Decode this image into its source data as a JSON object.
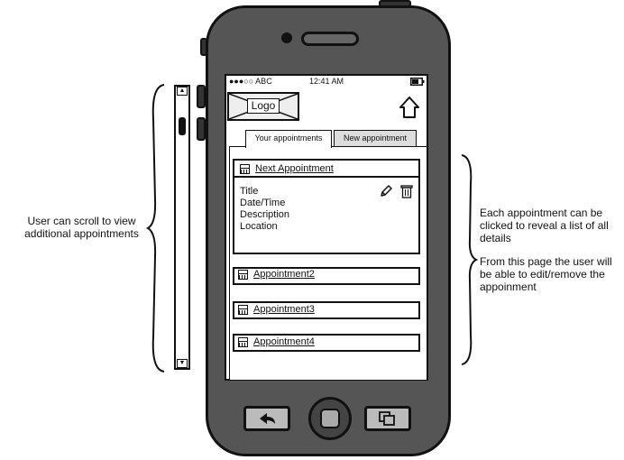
{
  "annotations": {
    "scroll_note": "User can scroll to view additional appointments",
    "click_note": "Each appointment can be clicked to reveal a list of all details",
    "edit_note": "From this page the user will be able to edit/remove the appoinment"
  },
  "status_bar": {
    "carrier": "●●●○○ ABC",
    "time": "12:41 AM"
  },
  "header": {
    "logo_label": "Logo"
  },
  "tabs": [
    {
      "label": "Your appointments",
      "active": true
    },
    {
      "label": "New appointment",
      "active": false
    }
  ],
  "next_appointment": {
    "title": "Next Appointment",
    "fields": [
      "Title",
      "Date/Time",
      "Description",
      "Location"
    ]
  },
  "appointments": [
    {
      "title": "Appointment2"
    },
    {
      "title": "Appointment3"
    },
    {
      "title": "Appointment4"
    }
  ],
  "icons": {
    "home": "home-icon",
    "edit": "pencil-icon",
    "delete": "trash-icon",
    "calendar": "calendar-icon",
    "back": "back-arrow-icon",
    "multitask": "windows-icon",
    "battery": "battery-icon"
  }
}
